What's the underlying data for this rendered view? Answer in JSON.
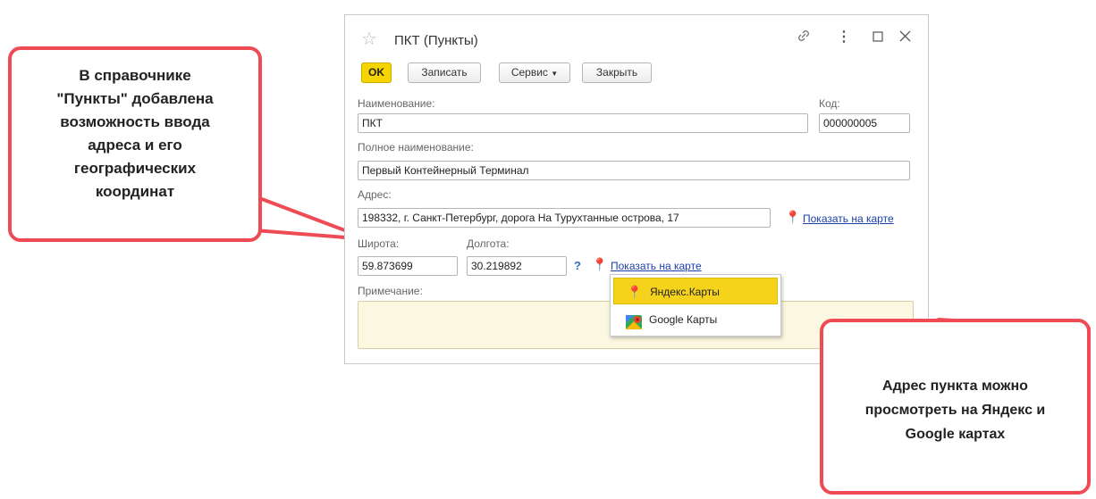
{
  "window": {
    "title": "ПКТ (Пункты)",
    "icons": [
      "star-icon",
      "link-icon",
      "more-icon",
      "maximize-icon",
      "close-icon"
    ]
  },
  "toolbar": {
    "ok": "OK",
    "save": "Записать",
    "service": "Сервис",
    "close": "Закрыть"
  },
  "form": {
    "name_label": "Наименование:",
    "name_value": "ПКТ",
    "code_label": "Код:",
    "code_value": "000000005",
    "fullname_label": "Полное наименование:",
    "fullname_value": "Первый Контейнерный Терминал",
    "address_label": "Адрес:",
    "address_value": "198332, г. Санкт-Петербург, дорога На Турухтанные острова, 17",
    "show_on_map": "Показать на карте",
    "lat_label": "Широта:",
    "lat_value": "59.873699",
    "lon_label": "Долгота:",
    "lon_value": "30.219892",
    "help": "?",
    "show_on_map_coords": "Показать на карте",
    "note_label": "Примечание:"
  },
  "map_menu": {
    "items": [
      {
        "label": "Яндекс.Карты",
        "icon": "yandex-maps-icon",
        "highlighted": true
      },
      {
        "label": "Google Карты",
        "icon": "google-maps-icon",
        "highlighted": false
      }
    ]
  },
  "callouts": {
    "left": [
      "В справочнике",
      "\"Пункты\" добавлена",
      "возможность ввода",
      "адреса и его",
      "географических",
      "координат"
    ],
    "right": [
      "Адрес пункта можно",
      "просмотреть на Яндекс и",
      "Google картах"
    ]
  },
  "colors": {
    "callout_border": "#ee4b55",
    "ok_button": "#f5d400",
    "menu_highlight": "#f5d21c",
    "link": "#1a3fa8",
    "pin": "#d0021b"
  }
}
